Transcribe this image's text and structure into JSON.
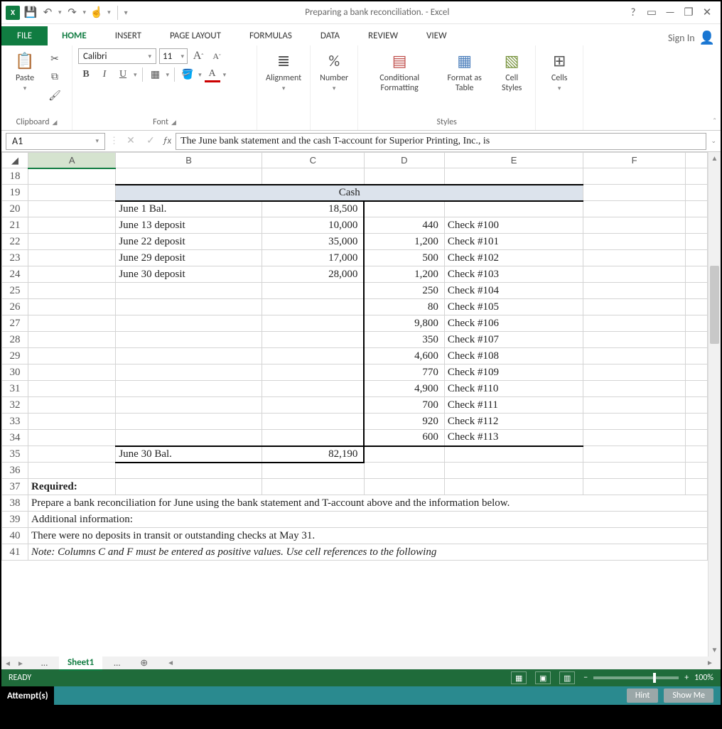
{
  "title": "Preparing a bank reconciliation. - Excel",
  "titlebar": {
    "help": "?",
    "ribbonOpts": "▭",
    "min": "—",
    "restore": "❐",
    "close": "✕"
  },
  "qat": {
    "save": "💾",
    "undo": "↶",
    "redo": "↷",
    "touch": "☝",
    "more": "▾"
  },
  "tabs": {
    "file": "FILE",
    "home": "HOME",
    "insert": "INSERT",
    "pagelayout": "PAGE LAYOUT",
    "formulas": "FORMULAS",
    "datat": "DATA",
    "review": "REVIEW",
    "view": "VIEW",
    "signin": "Sign In"
  },
  "ribbon": {
    "clipboard": {
      "label": "Clipboard",
      "paste": "Paste"
    },
    "font": {
      "label": "Font",
      "name": "Calibri",
      "size": "11",
      "growA": "A",
      "shrinkA": "A",
      "bold": "B",
      "italic": "I",
      "underline": "U"
    },
    "alignment": {
      "label": "Alignment",
      "glyph": "≣"
    },
    "number": {
      "label": "Number",
      "glyph": "%"
    },
    "styles": {
      "label": "Styles",
      "cond": "Conditional Formatting",
      "fmt": "Format as Table",
      "cell": "Cell Styles"
    },
    "cells": {
      "label": "Cells"
    }
  },
  "formulaBar": {
    "name": "A1",
    "cancel": "✕",
    "enter": "✓",
    "fx": "ƒx",
    "value": "The June bank statement and the cash T-account for Superior Printing, Inc., is"
  },
  "columns": [
    "A",
    "B",
    "C",
    "D",
    "E",
    "F"
  ],
  "rows": {
    "start": 18,
    "end": 41,
    "cashHeader": "Cash",
    "data": {
      "19": {
        "merge": "cash"
      },
      "20": {
        "B": "June 1 Bal.",
        "C": "18,500"
      },
      "21": {
        "B": "June 13 deposit",
        "C": "10,000",
        "D": "440",
        "E": "Check #100"
      },
      "22": {
        "B": "June 22 deposit",
        "C": "35,000",
        "D": "1,200",
        "E": "Check #101"
      },
      "23": {
        "B": "June 29 deposit",
        "C": "17,000",
        "D": "500",
        "E": "Check #102"
      },
      "24": {
        "B": "June 30 deposit",
        "C": "28,000",
        "D": "1,200",
        "E": "Check #103"
      },
      "25": {
        "D": "250",
        "E": "Check #104"
      },
      "26": {
        "D": "80",
        "E": "Check #105"
      },
      "27": {
        "D": "9,800",
        "E": "Check #106"
      },
      "28": {
        "D": "350",
        "E": "Check #107"
      },
      "29": {
        "D": "4,600",
        "E": "Check #108"
      },
      "30": {
        "D": "770",
        "E": "Check #109"
      },
      "31": {
        "D": "4,900",
        "E": "Check #110"
      },
      "32": {
        "D": "700",
        "E": "Check #111"
      },
      "33": {
        "D": "920",
        "E": "Check #112"
      },
      "34": {
        "D": "600",
        "E": "Check #113"
      },
      "35": {
        "B": "June 30 Bal.",
        "C": "82,190"
      },
      "37": {
        "A": "Required:",
        "bold": true
      },
      "38": {
        "span": "Prepare a bank reconciliation for June using the bank statement and T-account above and the information below."
      },
      "39": {
        "span": "Additional information:"
      },
      "40": {
        "span": "There were no deposits in transit or outstanding checks at May 31."
      },
      "41": {
        "span": "Note: Columns C and F must be entered as positive values.  Use cell references to the following",
        "ital": true
      }
    }
  },
  "sheetTabs": {
    "dots": "…",
    "active": "Sheet1",
    "dots2": "…",
    "add": "⊕"
  },
  "status": {
    "ready": "READY",
    "zoom": "100%"
  },
  "attempt": {
    "label": "Attempt(s)",
    "hint": "Hint",
    "showme": "Show Me"
  }
}
